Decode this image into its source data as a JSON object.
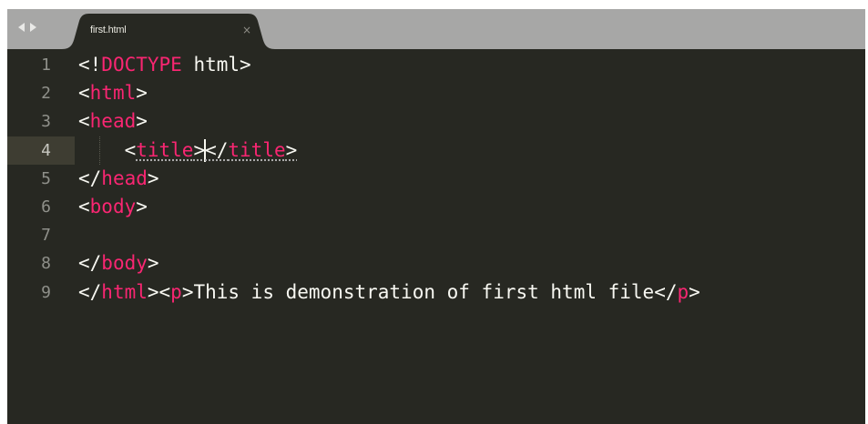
{
  "tab": {
    "filename": "first.html",
    "close_glyph": "×"
  },
  "nav": {
    "back_icon": "triangle-left-icon",
    "forward_icon": "triangle-right-icon"
  },
  "colors": {
    "background": "#272822",
    "tag": "#f92672",
    "text": "#f8f8f2",
    "line_number": "#8f908a",
    "tab_bar": "#a7a7a6"
  },
  "editor": {
    "current_line": 4,
    "lines": [
      {
        "num": "1",
        "tokens": [
          {
            "t": "p",
            "v": "<!"
          },
          {
            "t": "t",
            "v": "DOCTYPE"
          },
          {
            "t": "p",
            "v": " html>"
          }
        ]
      },
      {
        "num": "2",
        "tokens": [
          {
            "t": "p",
            "v": "<"
          },
          {
            "t": "t",
            "v": "html"
          },
          {
            "t": "p",
            "v": ">"
          }
        ]
      },
      {
        "num": "3",
        "tokens": [
          {
            "t": "p",
            "v": "<"
          },
          {
            "t": "t",
            "v": "head"
          },
          {
            "t": "p",
            "v": ">"
          }
        ]
      },
      {
        "num": "4",
        "tokens": [
          {
            "t": "p",
            "v": "    <"
          },
          {
            "t": "t",
            "v": "title"
          },
          {
            "t": "p",
            "v": ">"
          },
          {
            "t": "caret",
            "v": ""
          },
          {
            "t": "p",
            "v": "</"
          },
          {
            "t": "t",
            "v": "title"
          },
          {
            "t": "p",
            "v": ">"
          }
        ]
      },
      {
        "num": "5",
        "tokens": [
          {
            "t": "p",
            "v": "</"
          },
          {
            "t": "t",
            "v": "head"
          },
          {
            "t": "p",
            "v": ">"
          }
        ]
      },
      {
        "num": "6",
        "tokens": [
          {
            "t": "p",
            "v": "<"
          },
          {
            "t": "t",
            "v": "body"
          },
          {
            "t": "p",
            "v": ">"
          }
        ]
      },
      {
        "num": "7",
        "tokens": []
      },
      {
        "num": "8",
        "tokens": [
          {
            "t": "p",
            "v": "</"
          },
          {
            "t": "t",
            "v": "body"
          },
          {
            "t": "p",
            "v": ">"
          }
        ]
      },
      {
        "num": "9",
        "tokens": [
          {
            "t": "p",
            "v": "</"
          },
          {
            "t": "t",
            "v": "html"
          },
          {
            "t": "p",
            "v": "><"
          },
          {
            "t": "t",
            "v": "p"
          },
          {
            "t": "p",
            "v": ">This is demonstration of first html file</"
          },
          {
            "t": "t",
            "v": "p"
          },
          {
            "t": "p",
            "v": ">"
          }
        ]
      }
    ]
  }
}
